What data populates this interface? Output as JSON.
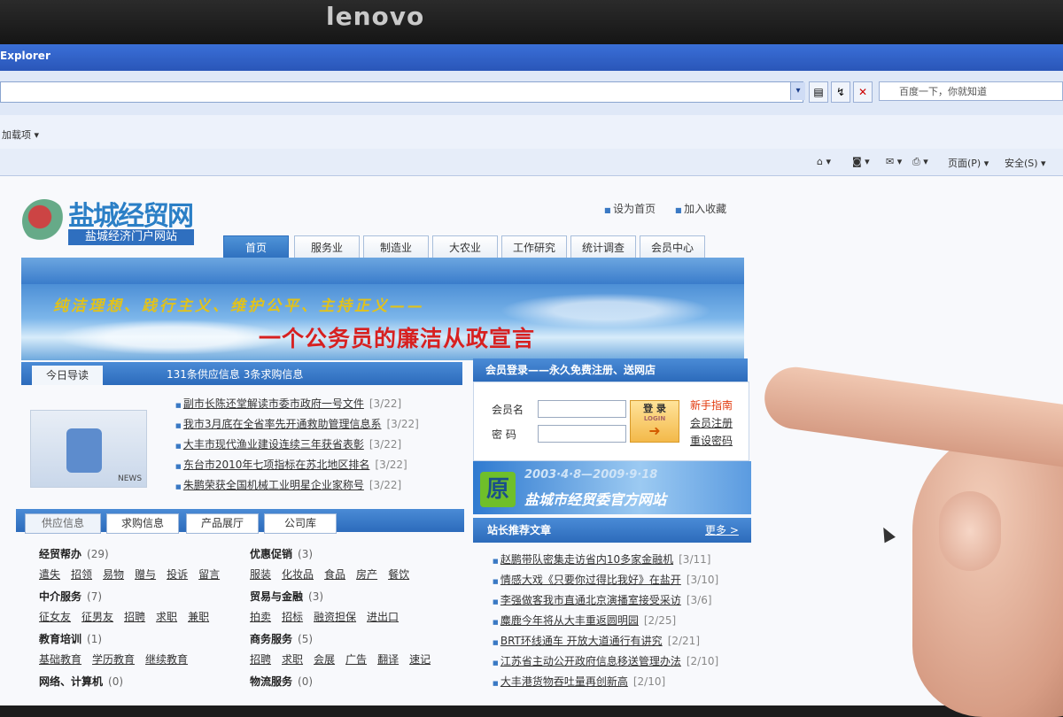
{
  "monitor": {
    "brand": "lenovo"
  },
  "browser": {
    "title": "Explorer",
    "search_placeholder": "百度一下，你就知道",
    "addons_label": "加载项 ▾",
    "commands": [
      "页面(P) ▾",
      "安全(S) ▾"
    ]
  },
  "site": {
    "logo_big": "盐城经贸网",
    "logo_small": "盐城经济门户网站",
    "toplinks": [
      "设为首页",
      "加入收藏"
    ],
    "nav": [
      "首页",
      "服务业",
      "制造业",
      "大农业",
      "工作研究",
      "统计调查",
      "会员中心"
    ],
    "banner": {
      "slogan1": "纯洁理想、践行主义、维护公平、主持正义——",
      "slogan2": "一个公务员的廉洁从政宣言"
    },
    "daily": {
      "tab": "今日导读",
      "info": "131条供应信息 3条求购信息",
      "news_tag": "NEWS",
      "items": [
        {
          "title": "副市长陈还堂解读市委市政府一号文件",
          "date": "[3/22]"
        },
        {
          "title": "我市3月底在全省率先开通救助管理信息系",
          "date": "[3/22]"
        },
        {
          "title": "大丰市现代渔业建设连续三年获省表彰",
          "date": "[3/22]"
        },
        {
          "title": "东台市2010年七项指标在苏北地区排名",
          "date": "[3/22]"
        },
        {
          "title": "朱鹏荣获全国机械工业明星企业家称号",
          "date": "[3/22]"
        }
      ]
    },
    "info_tabs": [
      "供应信息",
      "求购信息",
      "产品展厅",
      "公司库"
    ],
    "categories": [
      {
        "name": "经贸帮办",
        "count": "(29)",
        "links": [
          "遣失",
          "招领",
          "易物",
          "赠与",
          "投诉",
          "留言"
        ]
      },
      {
        "name": "中介服务",
        "count": "(7)",
        "links": [
          "征女友",
          "征男友",
          "招聘",
          "求职",
          "兼职"
        ]
      },
      {
        "name": "教育培训",
        "count": "(1)",
        "links": [
          "基础教育",
          "学历教育",
          "继续教育"
        ]
      },
      {
        "name": "网络、计算机",
        "count": "(0)",
        "links": []
      },
      {
        "name": "优惠促销",
        "count": "(3)",
        "links": [
          "服装",
          "化妆品",
          "食品",
          "房产",
          "餐饮"
        ]
      },
      {
        "name": "贸易与金融",
        "count": "(3)",
        "links": [
          "拍卖",
          "招标",
          "融资担保",
          "进出口"
        ]
      },
      {
        "name": "商务服务",
        "count": "(5)",
        "links": [
          "招聘",
          "求职",
          "会展",
          "广告",
          "翻译",
          "速记"
        ]
      },
      {
        "name": "物流服务",
        "count": "(0)",
        "links": []
      }
    ],
    "login": {
      "header": "会员登录——永久免费注册、送网店",
      "member_label": "会员名",
      "password_label": "密 码",
      "login_button": "登 录",
      "login_button_sub": "LOGIN",
      "guide": "新手指南",
      "register": "会员注册",
      "reset": "重设密码"
    },
    "anniversary": {
      "dates": "2003·4·8—2009·9·18",
      "name": "盐城市经贸委官方网站"
    },
    "recommend": {
      "header": "站长推荐文章",
      "more": "更多 >",
      "items": [
        {
          "title": "赵鹏带队密集走访省内10多家金融机",
          "date": "[3/11]"
        },
        {
          "title": "情感大戏《只要你过得比我好》在盐开",
          "date": "[3/10]"
        },
        {
          "title": "李强做客我市直通北京演播室接受采访",
          "date": "[3/6]"
        },
        {
          "title": "麋鹿今年将从大丰重返圆明园",
          "date": "[2/25]"
        },
        {
          "title": "BRT环线通车 开放大道通行有讲究",
          "date": "[2/21]"
        },
        {
          "title": "江苏省主动公开政府信息移送管理办法",
          "date": "[2/10]"
        },
        {
          "title": "大丰港货物吞吐量再创新高",
          "date": "[2/10]"
        }
      ]
    }
  }
}
